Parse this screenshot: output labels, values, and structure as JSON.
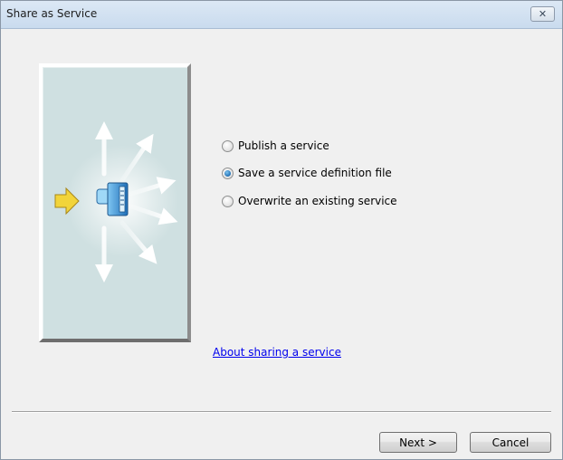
{
  "window": {
    "title": "Share as Service",
    "close_glyph": "✕"
  },
  "options": [
    {
      "label": "Publish a service",
      "checked": false
    },
    {
      "label": "Save a service definition file",
      "checked": true
    },
    {
      "label": "Overwrite an existing service",
      "checked": false
    }
  ],
  "help_link": "About sharing a service",
  "buttons": {
    "next_label": "Next >",
    "cancel_label": "Cancel"
  },
  "illustration": {
    "icons": [
      "yellow-arrow-icon",
      "server-icon",
      "outgoing-arrows-icon"
    ],
    "colors": {
      "panel_bg": "#cfe0e1",
      "arrow_yellow": "#f2d43a",
      "server_blue": "#3b8fd6"
    }
  }
}
